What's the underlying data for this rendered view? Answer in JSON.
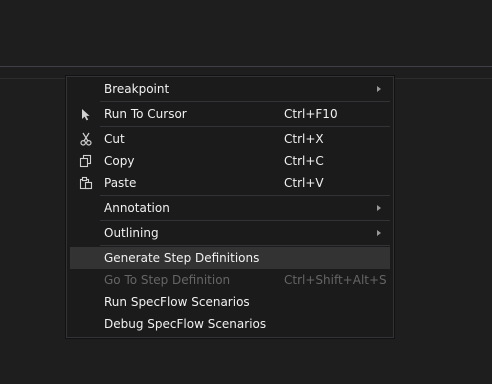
{
  "menu": {
    "items": [
      {
        "label": "Breakpoint",
        "shortcut": "",
        "submenu": true
      },
      {
        "label": "Run To Cursor",
        "shortcut": "Ctrl+F10",
        "icon": "cursor-icon"
      },
      {
        "label": "Cut",
        "shortcut": "Ctrl+X",
        "icon": "scissors-icon"
      },
      {
        "label": "Copy",
        "shortcut": "Ctrl+C",
        "icon": "copy-icon"
      },
      {
        "label": "Paste",
        "shortcut": "Ctrl+V",
        "icon": "paste-icon"
      },
      {
        "label": "Annotation",
        "shortcut": "",
        "submenu": true
      },
      {
        "label": "Outlining",
        "shortcut": "",
        "submenu": true
      },
      {
        "label": "Generate Step Definitions",
        "shortcut": "",
        "highlighted": true
      },
      {
        "label": "Go To Step Definition",
        "shortcut": "Ctrl+Shift+Alt+S",
        "disabled": true
      },
      {
        "label": "Run SpecFlow Scenarios",
        "shortcut": ""
      },
      {
        "label": "Debug SpecFlow Scenarios",
        "shortcut": ""
      }
    ]
  },
  "colors": {
    "background": "#1e1e1e",
    "menu_background": "#1b1b1c",
    "highlight": "#333334",
    "text": "#f1f1f1",
    "disabled_text": "#656565"
  }
}
